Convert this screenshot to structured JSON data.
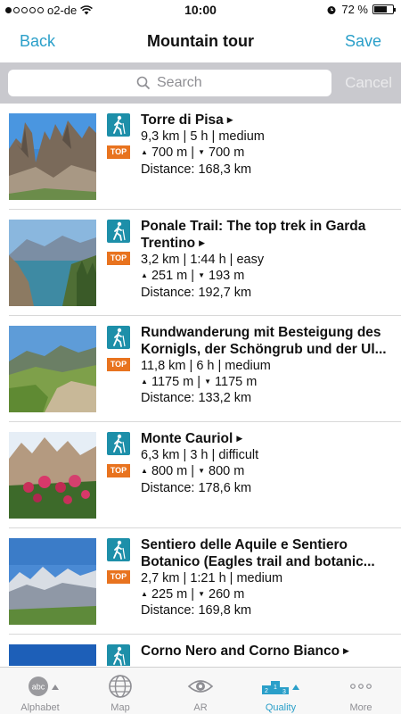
{
  "status_bar": {
    "carrier": "o2-de",
    "time": "10:00",
    "battery": "72 %",
    "battery_level": 0.72
  },
  "nav": {
    "back_label": "Back",
    "title": "Mountain tour",
    "save_label": "Save"
  },
  "search": {
    "placeholder": "Search",
    "cancel_label": "Cancel"
  },
  "colors": {
    "accent": "#2a9fc9",
    "hike_icon_bg": "#1d8fa9",
    "top_badge": "#e8731f"
  },
  "tours": [
    {
      "name": "Torre di Pisa",
      "stats": "9,3 km | 5 h | medium",
      "ascent": "700 m",
      "descent": "700 m",
      "distance": "Distance: 168,3 km",
      "badge": "TOP",
      "icon": "hiking-icon"
    },
    {
      "name": "Ponale Trail: The top trek in Garda Trentino",
      "stats": "3,2 km | 1:44 h | easy",
      "ascent": "251 m",
      "descent": "193 m",
      "distance": "Distance: 192,7 km",
      "badge": "TOP",
      "icon": "hiking-icon"
    },
    {
      "name": "Rundwanderung mit Besteigung des Kornigls, der Schöngrub und der Ul...",
      "stats": "11,8 km | 6 h | medium",
      "ascent": "1175 m",
      "descent": "1175 m",
      "distance": "Distance: 133,2 km",
      "badge": "TOP",
      "icon": "hiking-icon"
    },
    {
      "name": "Monte Cauriol",
      "stats": "6,3 km | 3 h | difficult",
      "ascent": "800 m",
      "descent": "800 m",
      "distance": "Distance: 178,6 km",
      "badge": "TOP",
      "icon": "hiking-icon"
    },
    {
      "name": "Sentiero delle Aquile e Sentiero Botanico (Eagles trail and botanic...",
      "stats": "2,7 km | 1:21 h | medium",
      "ascent": "225 m",
      "descent": "260 m",
      "distance": "Distance: 169,8 km",
      "badge": "TOP",
      "icon": "hiking-icon"
    },
    {
      "name": "Corno Nero and Corno Bianco",
      "stats": "",
      "ascent": "",
      "descent": "",
      "distance": "",
      "badge": "",
      "icon": "hiking-icon"
    }
  ],
  "tabs": [
    {
      "label": "Alphabet",
      "icon": "abc-icon"
    },
    {
      "label": "Map",
      "icon": "globe-icon"
    },
    {
      "label": "AR",
      "icon": "eye-icon"
    },
    {
      "label": "Quality",
      "icon": "podium-icon",
      "active": true
    },
    {
      "label": "More",
      "icon": "more-dots-icon"
    }
  ]
}
